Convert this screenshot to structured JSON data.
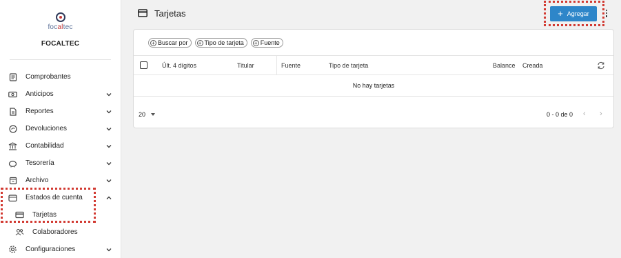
{
  "brand": {
    "logo_text_a": "foc",
    "logo_text_b": "al",
    "logo_text_c": "tec",
    "company": "FOCALTEC"
  },
  "sidebar": {
    "items": [
      {
        "label": "Comprobantes",
        "icon": "receipt-icon",
        "chevron": "none"
      },
      {
        "label": "Anticipos",
        "icon": "cash-icon",
        "chevron": "down"
      },
      {
        "label": "Reportes",
        "icon": "report-icon",
        "chevron": "down"
      },
      {
        "label": "Devoluciones",
        "icon": "return-icon",
        "chevron": "down"
      },
      {
        "label": "Contabilidad",
        "icon": "bank-icon",
        "chevron": "down"
      },
      {
        "label": "Tesorería",
        "icon": "piggy-bank-icon",
        "chevron": "down"
      },
      {
        "label": "Archivo",
        "icon": "archive-icon",
        "chevron": "down"
      },
      {
        "label": "Estados de cuenta",
        "icon": "account-statement-icon",
        "chevron": "up"
      }
    ],
    "subitems": [
      {
        "label": "Tarjetas",
        "icon": "card-icon"
      },
      {
        "label": "Colaboradores",
        "icon": "people-icon"
      }
    ],
    "last": {
      "label": "Configuraciones",
      "icon": "gear-icon",
      "chevron": "down"
    }
  },
  "header": {
    "title": "Tarjetas",
    "add_label": "Agregar",
    "highlight_color": "#d23a32",
    "accent": "#2e86c9"
  },
  "filters": [
    "Buscar por",
    "Tipo de tarjeta",
    "Fuente"
  ],
  "table": {
    "columns": [
      "Últ. 4 dígitos",
      "Titular",
      "Fuente",
      "Tipo de tarjeta",
      "Balance",
      "Creada"
    ],
    "empty_message": "No hay tarjetas"
  },
  "pagination": {
    "page_size": "20",
    "range": "0 - 0 de 0"
  }
}
